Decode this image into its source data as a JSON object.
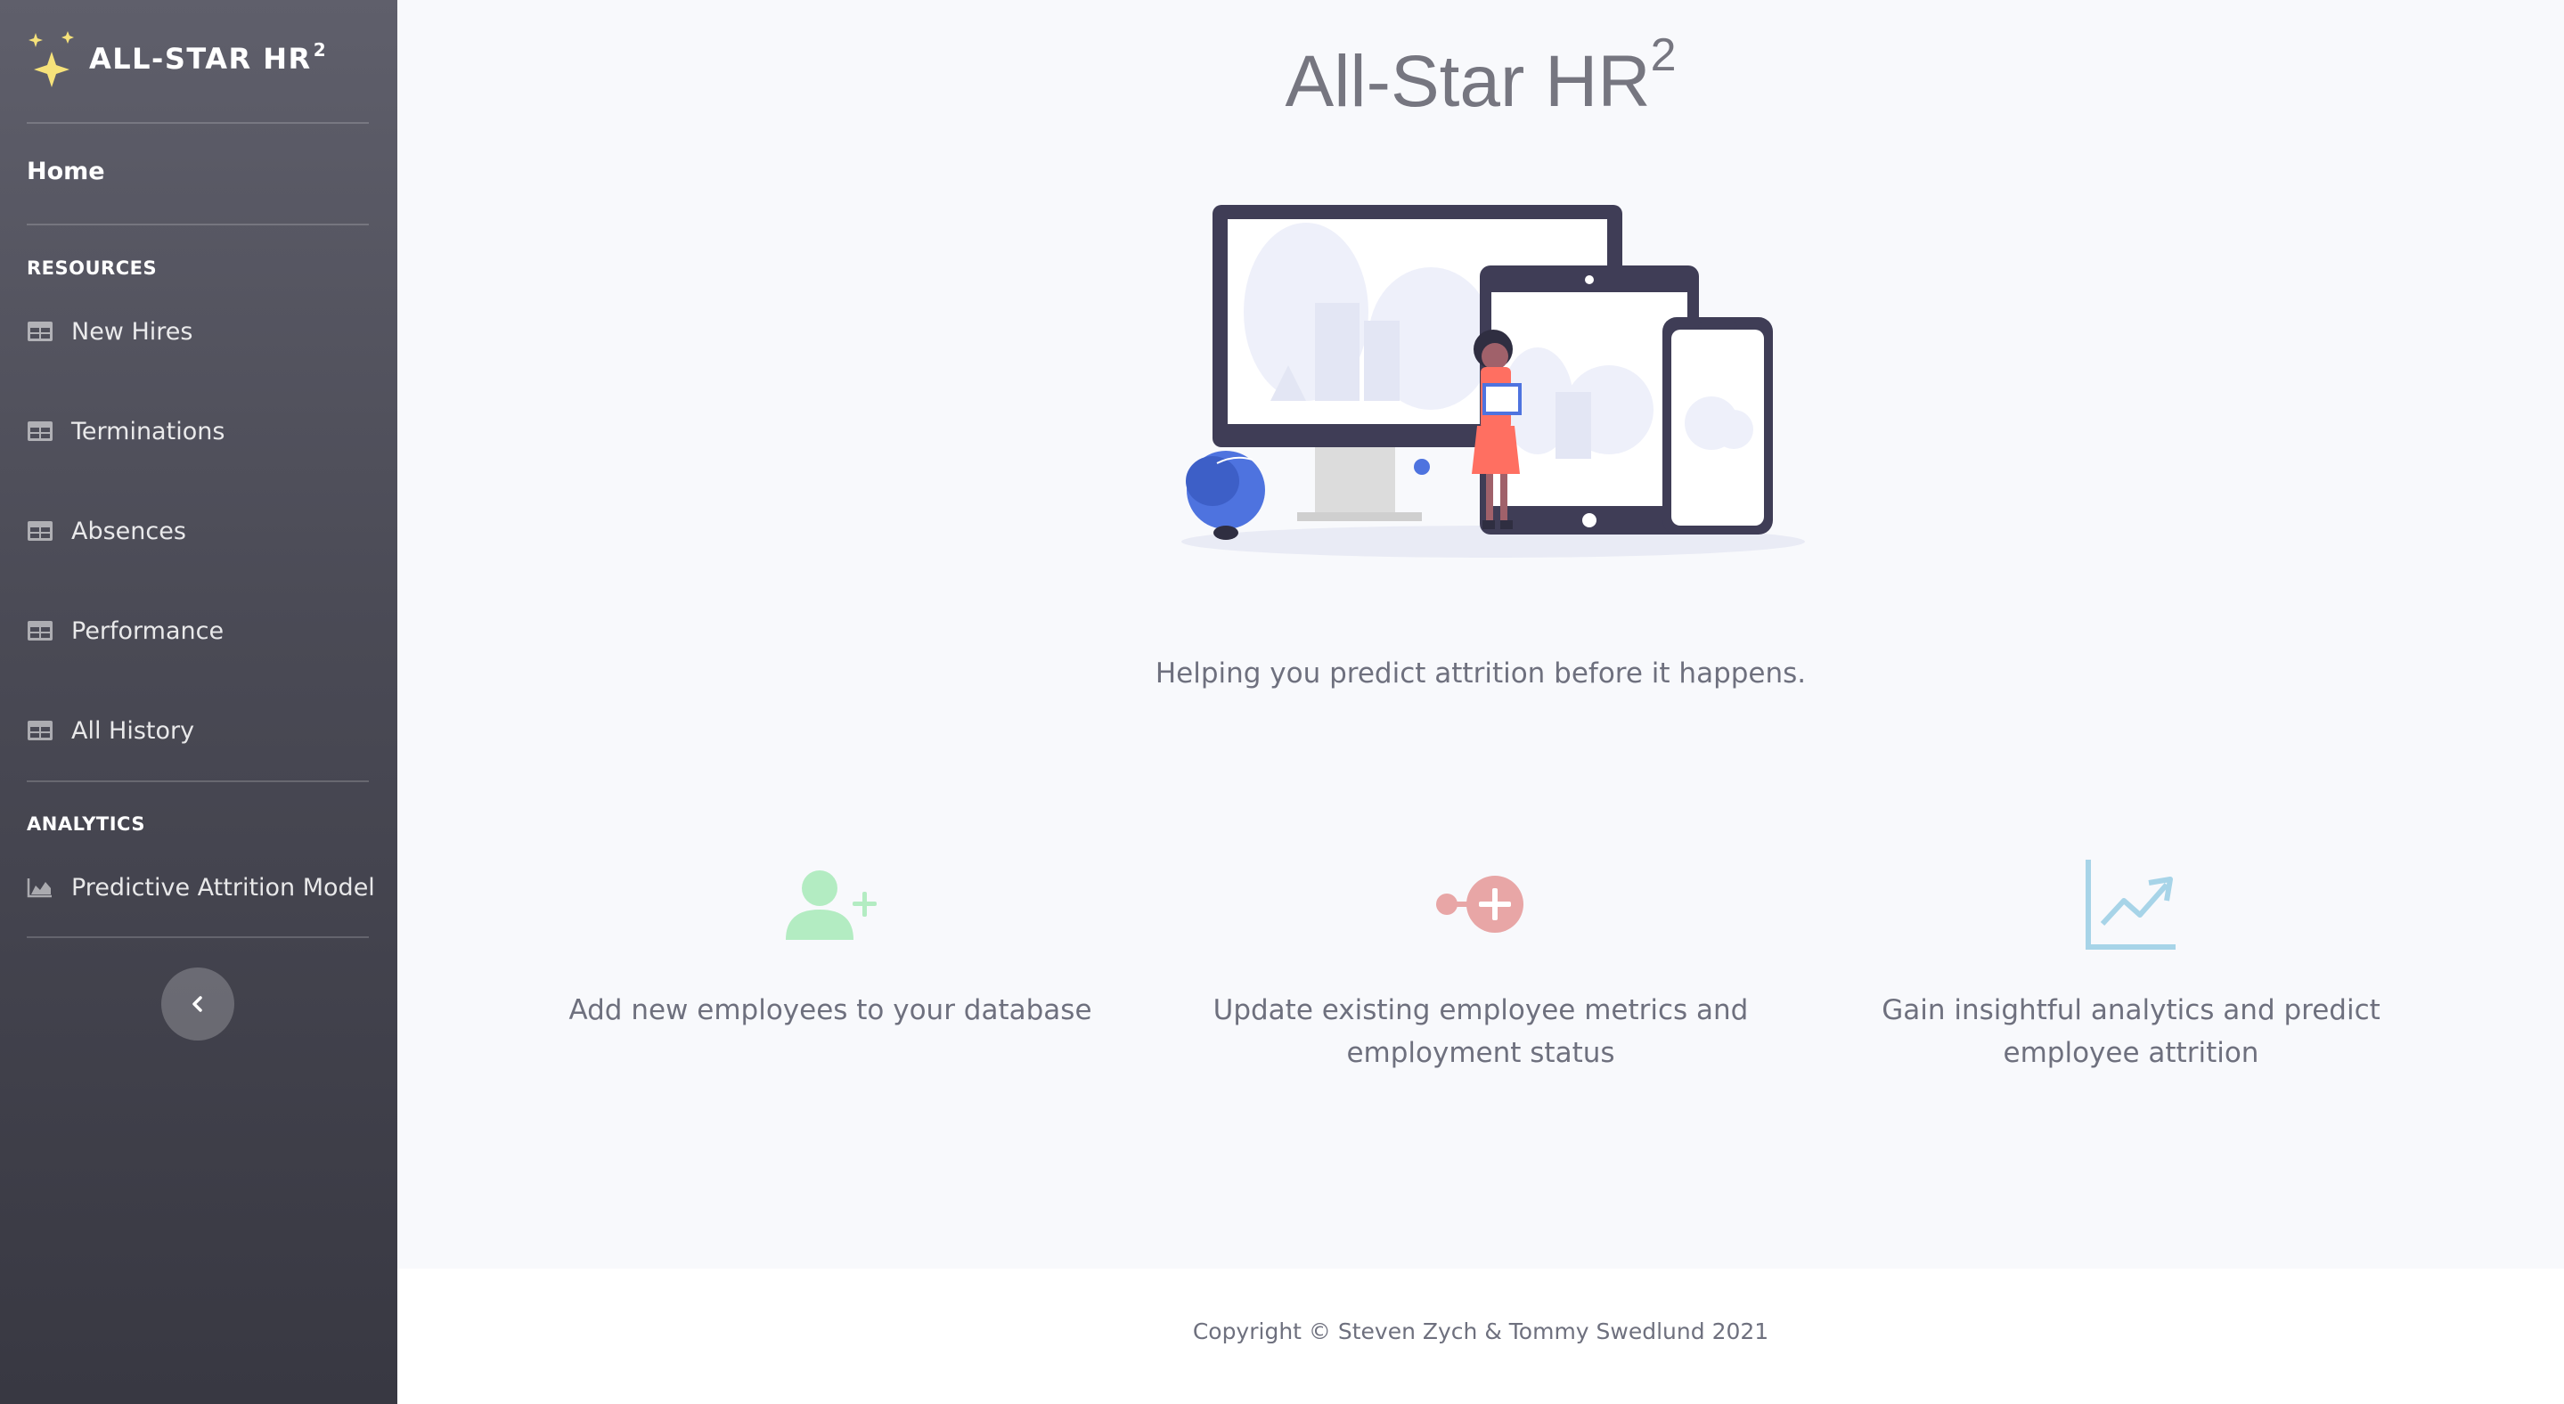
{
  "brand": {
    "name": "ALL-STAR HR",
    "superscript": "2"
  },
  "nav": {
    "home": "Home",
    "resources_heading": "RESOURCES",
    "resources": [
      "New Hires",
      "Terminations",
      "Absences",
      "Performance",
      "All History"
    ],
    "analytics_heading": "ANALYTICS",
    "analytics": [
      "Predictive Attrition Model"
    ]
  },
  "main": {
    "title": "All-Star HR",
    "title_superscript": "2",
    "tagline": "Helping you predict attrition before it happens.",
    "features": [
      {
        "icon": "user-plus-icon",
        "text": "Add new employees to your database",
        "color": "#b3ecc2"
      },
      {
        "icon": "update-plus-icon",
        "text": "Update existing employee metrics and employment status",
        "color": "#e8a6a6"
      },
      {
        "icon": "chart-line-icon",
        "text": "Gain insightful analytics and predict employee attrition",
        "color": "#a7d4e8"
      }
    ]
  },
  "footer": {
    "copyright": "Copyright © Steven Zych & Tommy Swedlund 2021"
  },
  "colors": {
    "accent_yellow": "#f6e27a",
    "sidebar_top": "#5f5f6b",
    "sidebar_bottom": "#383842",
    "hero_blue": "#4e73df"
  }
}
